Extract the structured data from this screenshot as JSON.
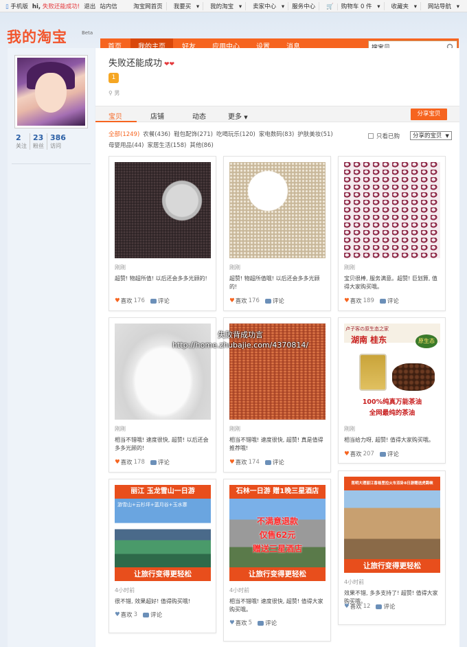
{
  "topbar": {
    "mobile": "手机版",
    "hi": "hi,",
    "username": "失败还能成功!",
    "logout": "退出",
    "messages": "站内信",
    "links": [
      "淘宝网首页",
      "我要买",
      "我的淘宝",
      "卖家中心",
      "服务中心",
      "购物车 0 件",
      "收藏夹",
      "网站导航"
    ]
  },
  "header": {
    "logo": "我的淘宝",
    "beta": "Beta",
    "nav": [
      "首页",
      "我的主页",
      "好友",
      "应用中心",
      "设置",
      "消息"
    ],
    "nav_active": 1,
    "search_value": "搜宝贝"
  },
  "profile": {
    "name": "失败还能成功",
    "hearts": "❤❤",
    "level": "1",
    "gender": "男",
    "stats": [
      {
        "num": "2",
        "label": "关注"
      },
      {
        "num": "23",
        "label": "粉丝"
      },
      {
        "num": "386",
        "label": "访问"
      }
    ]
  },
  "tabs": {
    "items": [
      "宝贝",
      "店铺",
      "动态",
      "更多"
    ],
    "share_button": "分享宝贝"
  },
  "categories": [
    "全部(1249)",
    "农餐(436)",
    "鞋包配饰(271)",
    "吃喝玩乐(120)",
    "家电数码(83)",
    "护肤美妆(51)",
    "母婴用品(44)",
    "家居生活(158)",
    "其他(86)"
  ],
  "filters": {
    "only_bought": "只看已购",
    "select": "分享的宝贝"
  },
  "cards": [
    {
      "src": "刚刚",
      "text": "超赞! 物超所值! 以后还会多多光顾的!",
      "likes_label": "喜欢",
      "likes": "176",
      "comment": "评论"
    },
    {
      "src": "刚刚",
      "text": "超赞! 物超所值哦! 以后还会多多光顾的!",
      "likes_label": "喜欢",
      "likes": "176",
      "comment": "评论"
    },
    {
      "src": "刚刚",
      "text": "宝贝很棒, 服务满意。超赞! 巨划算, 值得大家购买哦。",
      "likes_label": "喜欢",
      "likes": "189",
      "comment": "评论"
    },
    {
      "src": "刚刚",
      "text": "相当不错哦! 速度很快, 超赞! 以后还会多多光顾的!",
      "likes_label": "喜欢",
      "likes": "178",
      "comment": "评论"
    },
    {
      "src": "刚刚",
      "text": "相当不错哦! 速度很快, 超赞! 真是值得推荐哦!",
      "likes_label": "喜欢",
      "likes": "174",
      "comment": "评论"
    },
    {
      "src": "刚刚",
      "text": "相当给力呀, 超赞! 值得大家购买哦。",
      "likes_label": "喜欢",
      "likes": "207",
      "comment": "评论"
    },
    {
      "src": "4小时前",
      "text": "很不错, 效果超好! 值得购买哦!",
      "likes_label": "喜欢",
      "likes": "3",
      "comment": "评论"
    },
    {
      "src": "4小时前",
      "text": "相当不错哦! 速度很快, 超赞! 值得大家购买哦。",
      "likes_label": "喜欢",
      "likes": "5",
      "comment": "评论"
    },
    {
      "src": "4小时前",
      "text": "效果不错, 多多支持了! 超赞! 值得大家购买哦。",
      "likes_label": "喜欢",
      "likes": "12",
      "comment": "评论"
    }
  ],
  "oil": {
    "t1": "卢子客の原生态之家",
    "t2": "湖南 桂东",
    "t3": "原生态",
    "b1": "100%纯真万能茶油",
    "b2": "全网最纯的茶油"
  },
  "tours": [
    {
      "top": "丽江 玉龙雪山一日游",
      "sub": "游雪山+云杉坪+蓝月谷+玉水寨",
      "bot": "让旅行变得更轻松"
    },
    {
      "top": "石林一日游 赠1晚三星酒店",
      "big1": "不满意退款",
      "big2": "仅售62元",
      "big3": "赠送三星酒店",
      "bot": "让旅行变得更轻松"
    },
    {
      "top": "昆明大理丽江香格里拉火车双卧8日游赠送虎跳峡",
      "bot": "让旅行变得更轻松"
    }
  ],
  "watermark": {
    "line1": "失败背成功言",
    "line2": "http://home.zhubajie.com/4370814/"
  },
  "colors": {
    "brand": "#f6641f",
    "link": "#2b5fa5",
    "heart": "#e4393c"
  }
}
